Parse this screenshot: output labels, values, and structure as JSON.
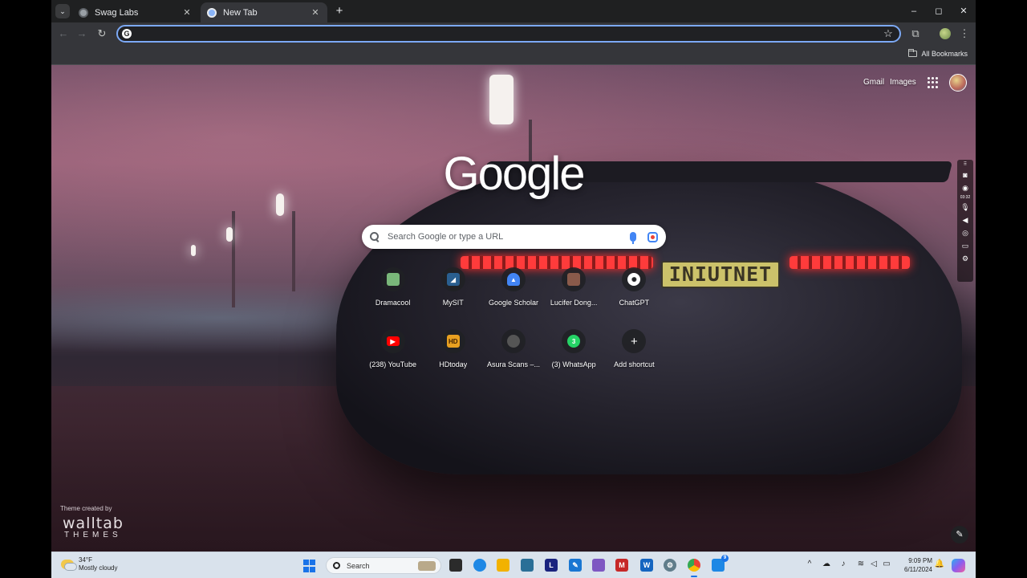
{
  "tabs": [
    {
      "title": "Swag Labs",
      "active": false
    },
    {
      "title": "New Tab",
      "active": true
    }
  ],
  "window_controls": {
    "minimize": "–",
    "maximize": "◻",
    "close": "✕"
  },
  "omnibox": {
    "value": "",
    "placeholder": ""
  },
  "bookmarks": {
    "all_label": "All Bookmarks"
  },
  "ntp": {
    "links": {
      "gmail": "Gmail",
      "images": "Images"
    },
    "logo": "Google",
    "search_placeholder": "Search Google or type a URL",
    "plate_text": "INIUTNET",
    "shortcuts": [
      {
        "label": "Dramacool",
        "icon": "dramacool-icon",
        "color": "#7ab87a"
      },
      {
        "label": "MySIT",
        "icon": "mysit-icon",
        "color": "#2a5f8f"
      },
      {
        "label": "Google Scholar",
        "icon": "scholar-icon",
        "color": "#4285f4"
      },
      {
        "label": "Lucifer Dong...",
        "icon": "lucifer-icon",
        "color": "#8a5a4a"
      },
      {
        "label": "ChatGPT",
        "icon": "chatgpt-icon",
        "color": "#ffffff"
      },
      {
        "label": "(238) YouTube",
        "icon": "youtube-icon",
        "color": "#ff0000"
      },
      {
        "label": "HDtoday",
        "icon": "hdtoday-icon",
        "color": "#e8a020"
      },
      {
        "label": "Asura Scans –...",
        "icon": "asura-icon",
        "color": "#555555"
      },
      {
        "label": "(3) WhatsApp",
        "icon": "whatsapp-icon",
        "color": "#25d366"
      },
      {
        "label": "Add shortcut",
        "icon": "plus-icon",
        "color": "#202124"
      }
    ],
    "theme_credit": "Theme created by",
    "theme_brand": "walltab",
    "theme_brand_sub": "THEMES"
  },
  "recorder": {
    "time": "03:32"
  },
  "taskbar": {
    "weather": {
      "temp": "34°F",
      "condition": "Mostly cloudy"
    },
    "search_placeholder": "Search",
    "clock": {
      "time": "9:09 PM",
      "date": "6/11/2024"
    },
    "chrome_badge": "9"
  }
}
